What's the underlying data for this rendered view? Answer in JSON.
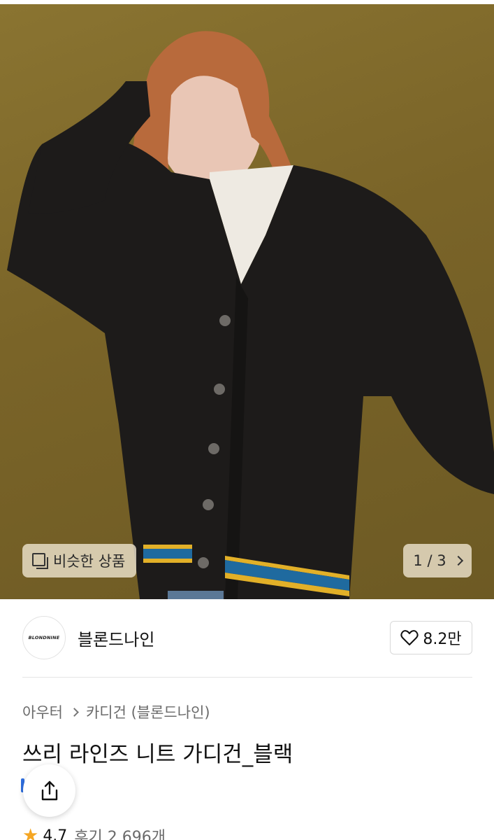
{
  "product_image": {
    "description_alt": "",
    "similar_button_label": "비슷한 상품",
    "pager": {
      "current": "1",
      "total": "3",
      "separator": "/"
    }
  },
  "brand": {
    "logo_text": "BLONDNINE",
    "name": "블론드나인",
    "like_count": "8.2만"
  },
  "breadcrumb": {
    "items": [
      "아우터",
      "카디건 (블론드나인)"
    ]
  },
  "product": {
    "title": "쓰리 라인즈 니트 가디건_블랙"
  },
  "rating": {
    "score": "4.7",
    "reviews_label": "후기 2,696개"
  },
  "colors": {
    "accent_star": "#f5a623",
    "background": "#ffffff",
    "hero_bg": "#7a6428"
  },
  "icons": {
    "similar": "square-stack-icon",
    "pager_next": "chevron-right-icon",
    "like": "heart-outline-icon",
    "share": "share-upload-icon",
    "star": "star-icon"
  }
}
